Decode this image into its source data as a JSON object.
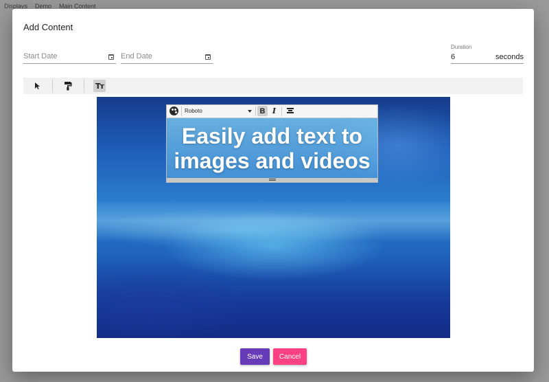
{
  "breadcrumbs": [
    "Displays",
    "Demo",
    "Main Content"
  ],
  "dialog": {
    "title": "Add Content",
    "start_date": {
      "placeholder": "Start Date"
    },
    "end_date": {
      "placeholder": "End Date"
    },
    "duration": {
      "label": "Duration",
      "value": "6",
      "unit": "seconds"
    }
  },
  "toolbar": {
    "tools": [
      {
        "name": "select-tool",
        "icon": "cursor-arrow-icon",
        "active": false
      },
      {
        "name": "paint-roller-tool",
        "icon": "paint-roller-icon",
        "active": false
      },
      {
        "name": "text-tool",
        "icon": "text-size-icon",
        "label": "Tт",
        "active": true
      }
    ]
  },
  "text_editor": {
    "font": "Roboto",
    "bold_label": "B",
    "italic_label": "I",
    "text_line1": "Easily add text to",
    "text_line2": "images and videos"
  },
  "actions": {
    "save": "Save",
    "cancel": "Cancel"
  },
  "colors": {
    "save": "#673ab7",
    "cancel": "#ff4081"
  }
}
